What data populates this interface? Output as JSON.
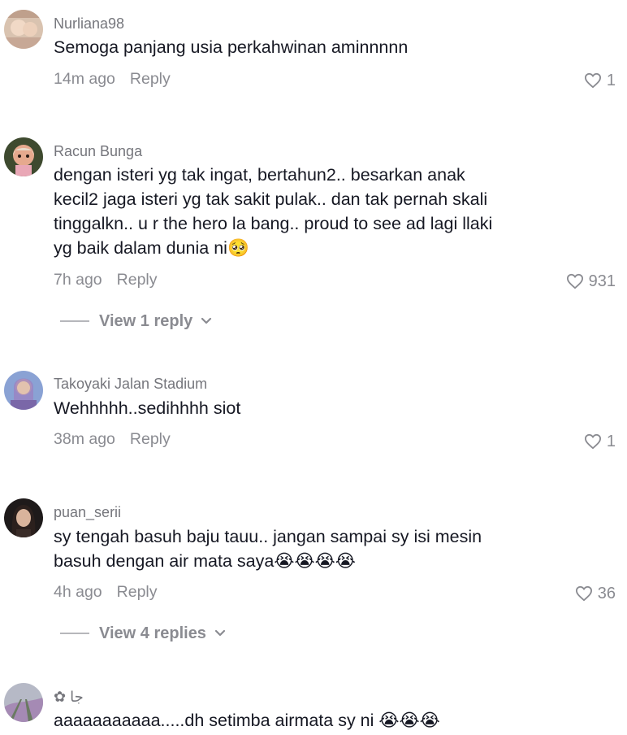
{
  "comments": [
    {
      "username": "Nurliana98",
      "text": "Semoga panjang usia perkahwinan aminnnnn",
      "time": "14m ago",
      "reply_label": "Reply",
      "likes": "1",
      "avatar_icon": "avatar-photo"
    },
    {
      "username": "Racun Bunga",
      "text": "dengan isteri yg tak ingat, bertahun2.. besarkan anak\nkecil2 jaga isteri yg tak sakit pulak.. dan tak pernah skali\ntinggalkn.. u r the hero la bang.. proud to see ad lagi llaki\nyg baik dalam dunia ni🥺",
      "time": "7h ago",
      "reply_label": "Reply",
      "likes": "931",
      "view_replies": "View 1 reply",
      "avatar_icon": "avatar-photo"
    },
    {
      "username": "Takoyaki Jalan Stadium",
      "text": "Wehhhhh..sedihhhh siot",
      "time": "38m ago",
      "reply_label": "Reply",
      "likes": "1",
      "avatar_icon": "avatar-photo"
    },
    {
      "username": "puan_serii",
      "text": "sy tengah basuh baju tauu.. jangan sampai sy isi mesin\nbasuh dengan air mata saya😭😭😭😭",
      "time": "4h ago",
      "reply_label": "Reply",
      "likes": "36",
      "view_replies": "View 4 replies",
      "avatar_icon": "avatar-photo"
    },
    {
      "username": "جا ✿",
      "text": "aaaaaaaaaaa.....dh setimba airmata sy ni 😭😭😭",
      "avatar_icon": "avatar-photo"
    }
  ],
  "colors": {
    "text": "#161823",
    "muted": "#8a8b91",
    "username": "#75767c"
  }
}
